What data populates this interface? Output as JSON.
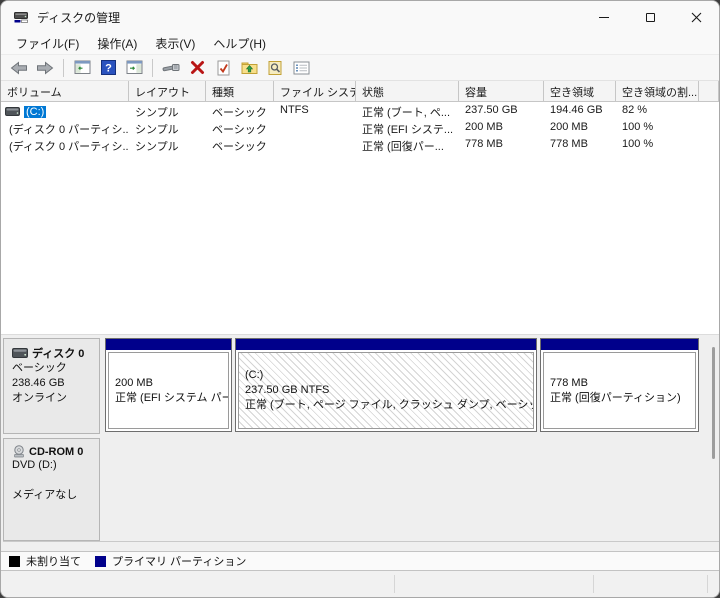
{
  "window": {
    "title": "ディスクの管理"
  },
  "menu": {
    "items": [
      {
        "label": "ファイル(F)"
      },
      {
        "label": "操作(A)"
      },
      {
        "label": "表示(V)"
      },
      {
        "label": "ヘルプ(H)"
      }
    ]
  },
  "toolbar": {
    "icons": [
      "back",
      "forward",
      "console-tree",
      "help",
      "action-pane",
      "properties-tool",
      "delete",
      "check-document",
      "folder-up",
      "search-document",
      "checklist"
    ]
  },
  "volume_list": {
    "columns": [
      "ボリューム",
      "レイアウト",
      "種類",
      "ファイル システム",
      "状態",
      "容量",
      "空き領域",
      "空き領域の割..."
    ],
    "rows": [
      {
        "volume": "(C:)",
        "layout": "シンプル",
        "type": "ベーシック",
        "fs": "NTFS",
        "status": "正常 (ブート, ペ...",
        "capacity": "237.50 GB",
        "free": "194.46 GB",
        "percent": "82 %"
      },
      {
        "volume": "(ディスク 0 パーティシ...",
        "layout": "シンプル",
        "type": "ベーシック",
        "fs": "",
        "status": "正常 (EFI システ...",
        "capacity": "200 MB",
        "free": "200 MB",
        "percent": "100 %"
      },
      {
        "volume": "(ディスク 0 パーティシ...",
        "layout": "シンプル",
        "type": "ベーシック",
        "fs": "",
        "status": "正常 (回復パー...",
        "capacity": "778 MB",
        "free": "778 MB",
        "percent": "100 %"
      }
    ]
  },
  "disk0": {
    "name": "ディスク 0",
    "type": "ベーシック",
    "size": "238.46 GB",
    "status": "オンライン",
    "partitions": [
      {
        "name": "",
        "line1": "200 MB",
        "line2": "正常 (EFI システム パーテ"
      },
      {
        "name": "(C:)",
        "line1": "237.50 GB NTFS",
        "line2": "正常 (ブート, ページ ファイル, クラッシュ ダンプ, ベーシック データ"
      },
      {
        "name": "",
        "line1": "778 MB",
        "line2": "正常 (回復パーティション)"
      }
    ]
  },
  "cdrom": {
    "name": "CD-ROM 0",
    "drive": "DVD (D:)",
    "status": "メディアなし"
  },
  "legend": {
    "items": [
      {
        "label": "未割り当て",
        "color": "#000000"
      },
      {
        "label": "プライマリ パーティション",
        "color": "#00008b"
      }
    ]
  },
  "colors": {
    "partition_bar": "#00008b",
    "selection": "#0078d4",
    "titlebar_bg": "#f9f9f9",
    "pane_bg": "#efefef"
  }
}
